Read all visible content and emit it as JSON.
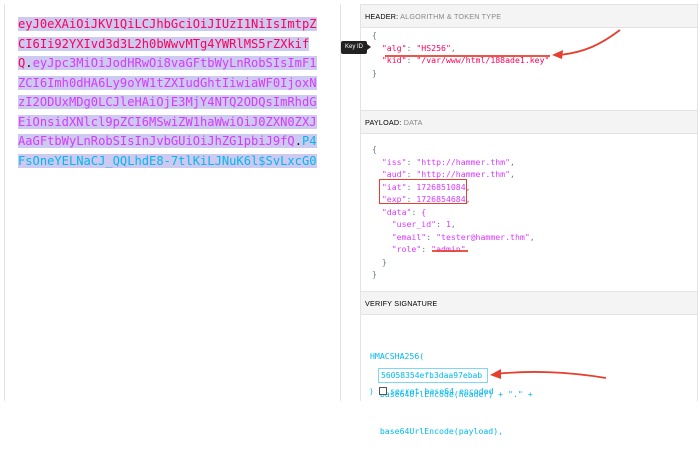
{
  "encoded": {
    "header_part": "eyJ0eXAiOiJKV1QiLCJhbGciOiJIUzI1NiIsImtpZCI6Ii92YXIvd3d3L2h0bWwvMTg4YWRlMS5rZXkifQ",
    "sep1": ".",
    "payload_part": "eyJpc3MiOiJodHRwOi8vaGFtbWyLnRobSIsImF1ZCI6Imh0dHA6Ly9oYW1tZXIudGhtIiwiaWF0IjoxNzI2ODUxMDg0LCJleHAiOjE3MjY4NTQ2ODQsImRhdGEiOnsidXNlcl9pZCI6MSwiZW1haWwiOiJ0ZXN0ZXJAaGFtbWyLnRobSIsInJvbGUiOiJhZG1pbiJ9fQ",
    "sep2": ".",
    "signature_part": "P4FsOneYELNaCJ_QQLhdE8-7tlKiLJNuK6l$SvLxcG0"
  },
  "header_section": {
    "title": "HEADER:",
    "subtitle": "ALGORITHM & TOKEN TYPE",
    "lines": [
      {
        "pre": "{",
        "key": "",
        "val": "",
        "post": ""
      },
      {
        "pre": "  ",
        "key": "\"alg\"",
        "val": "\"HS256\"",
        "post": ","
      },
      {
        "pre": "  ",
        "key": "\"kid\"",
        "val": "\"/var/www/html/188ade1.key\"",
        "post": ""
      },
      {
        "pre": "}",
        "key": "",
        "val": "",
        "post": ""
      }
    ],
    "tooltip": "Key ID"
  },
  "payload_section": {
    "title": "PAYLOAD:",
    "subtitle": "DATA",
    "lines": [
      {
        "pre": "{",
        "key": "",
        "val": "",
        "post": ""
      },
      {
        "pre": "  ",
        "key": "\"iss\"",
        "val": "\"http://hammer.thm\"",
        "post": ","
      },
      {
        "pre": "  ",
        "key": "\"aud\"",
        "val": "\"http://hammer.thm\"",
        "post": ","
      },
      {
        "pre": "  ",
        "key": "\"iat\"",
        "val": "1726851084",
        "post": ","
      },
      {
        "pre": "  ",
        "key": "\"exp\"",
        "val": "1726854684",
        "post": ","
      },
      {
        "pre": "  ",
        "key": "\"data\"",
        "val": "{",
        "post": ""
      },
      {
        "pre": "    ",
        "key": "\"user_id\"",
        "val": "1",
        "post": ","
      },
      {
        "pre": "    ",
        "key": "\"email\"",
        "val": "\"tester@hammer.thm\"",
        "post": ","
      },
      {
        "pre": "    ",
        "key": "\"role\"",
        "val": "\"admin\"",
        "post": ""
      },
      {
        "pre": "  }",
        "key": "",
        "val": "",
        "post": ""
      },
      {
        "pre": "}",
        "key": "",
        "val": "",
        "post": ""
      }
    ]
  },
  "signature_section": {
    "title": "VERIFY SIGNATURE",
    "lines": [
      "HMACSHA256(",
      "  base64UrlEncode(header) + \".\" +",
      "  base64UrlEncode(payload),"
    ],
    "secret_value": "56058354efb3daa97ebab",
    "close": ") ",
    "checkbox_label": "secret base64 encoded"
  },
  "colors": {
    "header": "#fb015b",
    "payload": "#d63aff",
    "signature": "#00b9f1",
    "annotation": "#e53f2e"
  }
}
